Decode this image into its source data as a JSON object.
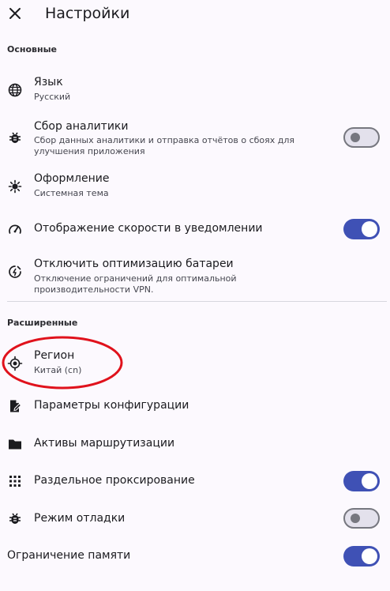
{
  "header": {
    "title": "Настройки"
  },
  "sections": {
    "basic": "Основные",
    "advanced": "Расширенные"
  },
  "items": {
    "language": {
      "label": "Язык",
      "value": "Русский"
    },
    "analytics": {
      "label": "Сбор аналитики",
      "description": "Сбор данных аналитики и отправка отчётов о сбоях для улучшения приложения",
      "enabled": false
    },
    "appearance": {
      "label": "Оформление",
      "value": "Системная тема"
    },
    "speed_notification": {
      "label": "Отображение скорости в уведомлении",
      "enabled": true
    },
    "battery": {
      "label": "Отключить оптимизацию батареи",
      "description": "Отключение ограничений для оптимальной производительности VPN."
    },
    "region": {
      "label": "Регион",
      "value": "Китай (cn)"
    },
    "config_params": {
      "label": "Параметры конфигурации"
    },
    "routing_assets": {
      "label": "Активы маршрутизации"
    },
    "split_proxy": {
      "label": "Раздельное проксирование",
      "enabled": true
    },
    "debug_mode": {
      "label": "Режим отладки",
      "enabled": false
    },
    "memory_limit": {
      "label": "Ограничение памяти",
      "enabled": true
    }
  },
  "colors": {
    "accent": "#3f51b5",
    "annotation": "#e0121c",
    "background": "#fcf9fe"
  }
}
